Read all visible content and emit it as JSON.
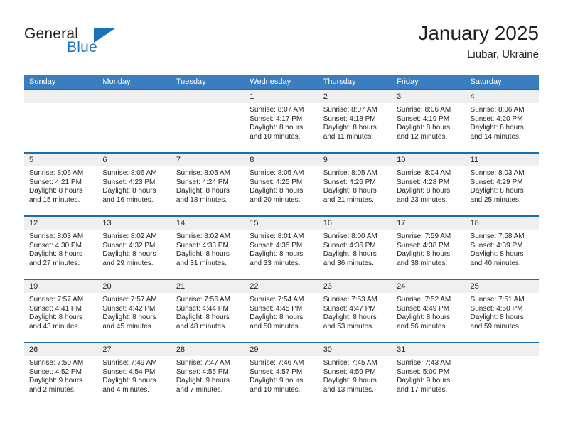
{
  "brand": {
    "name_part1": "General",
    "name_part2": "Blue",
    "triangle_color": "#1b72b8",
    "accent_color": "#1b77c3"
  },
  "header": {
    "month_title": "January 2025",
    "location": "Liubar, Ukraine"
  },
  "colors": {
    "weekday_header_bg": "#3b7ebf",
    "week_divider": "#1b6cb0",
    "day_band_bg": "#efefef",
    "text": "#231f20"
  },
  "weekdays": [
    "Sunday",
    "Monday",
    "Tuesday",
    "Wednesday",
    "Thursday",
    "Friday",
    "Saturday"
  ],
  "weeks": [
    [
      {
        "day": "",
        "sunrise": "",
        "sunset": "",
        "daylight_line1": "",
        "daylight_line2": ""
      },
      {
        "day": "",
        "sunrise": "",
        "sunset": "",
        "daylight_line1": "",
        "daylight_line2": ""
      },
      {
        "day": "",
        "sunrise": "",
        "sunset": "",
        "daylight_line1": "",
        "daylight_line2": ""
      },
      {
        "day": "1",
        "sunrise": "Sunrise: 8:07 AM",
        "sunset": "Sunset: 4:17 PM",
        "daylight_line1": "Daylight: 8 hours",
        "daylight_line2": "and 10 minutes."
      },
      {
        "day": "2",
        "sunrise": "Sunrise: 8:07 AM",
        "sunset": "Sunset: 4:18 PM",
        "daylight_line1": "Daylight: 8 hours",
        "daylight_line2": "and 11 minutes."
      },
      {
        "day": "3",
        "sunrise": "Sunrise: 8:06 AM",
        "sunset": "Sunset: 4:19 PM",
        "daylight_line1": "Daylight: 8 hours",
        "daylight_line2": "and 12 minutes."
      },
      {
        "day": "4",
        "sunrise": "Sunrise: 8:06 AM",
        "sunset": "Sunset: 4:20 PM",
        "daylight_line1": "Daylight: 8 hours",
        "daylight_line2": "and 14 minutes."
      }
    ],
    [
      {
        "day": "5",
        "sunrise": "Sunrise: 8:06 AM",
        "sunset": "Sunset: 4:21 PM",
        "daylight_line1": "Daylight: 8 hours",
        "daylight_line2": "and 15 minutes."
      },
      {
        "day": "6",
        "sunrise": "Sunrise: 8:06 AM",
        "sunset": "Sunset: 4:23 PM",
        "daylight_line1": "Daylight: 8 hours",
        "daylight_line2": "and 16 minutes."
      },
      {
        "day": "7",
        "sunrise": "Sunrise: 8:05 AM",
        "sunset": "Sunset: 4:24 PM",
        "daylight_line1": "Daylight: 8 hours",
        "daylight_line2": "and 18 minutes."
      },
      {
        "day": "8",
        "sunrise": "Sunrise: 8:05 AM",
        "sunset": "Sunset: 4:25 PM",
        "daylight_line1": "Daylight: 8 hours",
        "daylight_line2": "and 20 minutes."
      },
      {
        "day": "9",
        "sunrise": "Sunrise: 8:05 AM",
        "sunset": "Sunset: 4:26 PM",
        "daylight_line1": "Daylight: 8 hours",
        "daylight_line2": "and 21 minutes."
      },
      {
        "day": "10",
        "sunrise": "Sunrise: 8:04 AM",
        "sunset": "Sunset: 4:28 PM",
        "daylight_line1": "Daylight: 8 hours",
        "daylight_line2": "and 23 minutes."
      },
      {
        "day": "11",
        "sunrise": "Sunrise: 8:03 AM",
        "sunset": "Sunset: 4:29 PM",
        "daylight_line1": "Daylight: 8 hours",
        "daylight_line2": "and 25 minutes."
      }
    ],
    [
      {
        "day": "12",
        "sunrise": "Sunrise: 8:03 AM",
        "sunset": "Sunset: 4:30 PM",
        "daylight_line1": "Daylight: 8 hours",
        "daylight_line2": "and 27 minutes."
      },
      {
        "day": "13",
        "sunrise": "Sunrise: 8:02 AM",
        "sunset": "Sunset: 4:32 PM",
        "daylight_line1": "Daylight: 8 hours",
        "daylight_line2": "and 29 minutes."
      },
      {
        "day": "14",
        "sunrise": "Sunrise: 8:02 AM",
        "sunset": "Sunset: 4:33 PM",
        "daylight_line1": "Daylight: 8 hours",
        "daylight_line2": "and 31 minutes."
      },
      {
        "day": "15",
        "sunrise": "Sunrise: 8:01 AM",
        "sunset": "Sunset: 4:35 PM",
        "daylight_line1": "Daylight: 8 hours",
        "daylight_line2": "and 33 minutes."
      },
      {
        "day": "16",
        "sunrise": "Sunrise: 8:00 AM",
        "sunset": "Sunset: 4:36 PM",
        "daylight_line1": "Daylight: 8 hours",
        "daylight_line2": "and 36 minutes."
      },
      {
        "day": "17",
        "sunrise": "Sunrise: 7:59 AM",
        "sunset": "Sunset: 4:38 PM",
        "daylight_line1": "Daylight: 8 hours",
        "daylight_line2": "and 38 minutes."
      },
      {
        "day": "18",
        "sunrise": "Sunrise: 7:58 AM",
        "sunset": "Sunset: 4:39 PM",
        "daylight_line1": "Daylight: 8 hours",
        "daylight_line2": "and 40 minutes."
      }
    ],
    [
      {
        "day": "19",
        "sunrise": "Sunrise: 7:57 AM",
        "sunset": "Sunset: 4:41 PM",
        "daylight_line1": "Daylight: 8 hours",
        "daylight_line2": "and 43 minutes."
      },
      {
        "day": "20",
        "sunrise": "Sunrise: 7:57 AM",
        "sunset": "Sunset: 4:42 PM",
        "daylight_line1": "Daylight: 8 hours",
        "daylight_line2": "and 45 minutes."
      },
      {
        "day": "21",
        "sunrise": "Sunrise: 7:56 AM",
        "sunset": "Sunset: 4:44 PM",
        "daylight_line1": "Daylight: 8 hours",
        "daylight_line2": "and 48 minutes."
      },
      {
        "day": "22",
        "sunrise": "Sunrise: 7:54 AM",
        "sunset": "Sunset: 4:45 PM",
        "daylight_line1": "Daylight: 8 hours",
        "daylight_line2": "and 50 minutes."
      },
      {
        "day": "23",
        "sunrise": "Sunrise: 7:53 AM",
        "sunset": "Sunset: 4:47 PM",
        "daylight_line1": "Daylight: 8 hours",
        "daylight_line2": "and 53 minutes."
      },
      {
        "day": "24",
        "sunrise": "Sunrise: 7:52 AM",
        "sunset": "Sunset: 4:49 PM",
        "daylight_line1": "Daylight: 8 hours",
        "daylight_line2": "and 56 minutes."
      },
      {
        "day": "25",
        "sunrise": "Sunrise: 7:51 AM",
        "sunset": "Sunset: 4:50 PM",
        "daylight_line1": "Daylight: 8 hours",
        "daylight_line2": "and 59 minutes."
      }
    ],
    [
      {
        "day": "26",
        "sunrise": "Sunrise: 7:50 AM",
        "sunset": "Sunset: 4:52 PM",
        "daylight_line1": "Daylight: 9 hours",
        "daylight_line2": "and 2 minutes."
      },
      {
        "day": "27",
        "sunrise": "Sunrise: 7:49 AM",
        "sunset": "Sunset: 4:54 PM",
        "daylight_line1": "Daylight: 9 hours",
        "daylight_line2": "and 4 minutes."
      },
      {
        "day": "28",
        "sunrise": "Sunrise: 7:47 AM",
        "sunset": "Sunset: 4:55 PM",
        "daylight_line1": "Daylight: 9 hours",
        "daylight_line2": "and 7 minutes."
      },
      {
        "day": "29",
        "sunrise": "Sunrise: 7:46 AM",
        "sunset": "Sunset: 4:57 PM",
        "daylight_line1": "Daylight: 9 hours",
        "daylight_line2": "and 10 minutes."
      },
      {
        "day": "30",
        "sunrise": "Sunrise: 7:45 AM",
        "sunset": "Sunset: 4:59 PM",
        "daylight_line1": "Daylight: 9 hours",
        "daylight_line2": "and 13 minutes."
      },
      {
        "day": "31",
        "sunrise": "Sunrise: 7:43 AM",
        "sunset": "Sunset: 5:00 PM",
        "daylight_line1": "Daylight: 9 hours",
        "daylight_line2": "and 17 minutes."
      },
      {
        "day": "",
        "sunrise": "",
        "sunset": "",
        "daylight_line1": "",
        "daylight_line2": ""
      }
    ]
  ]
}
